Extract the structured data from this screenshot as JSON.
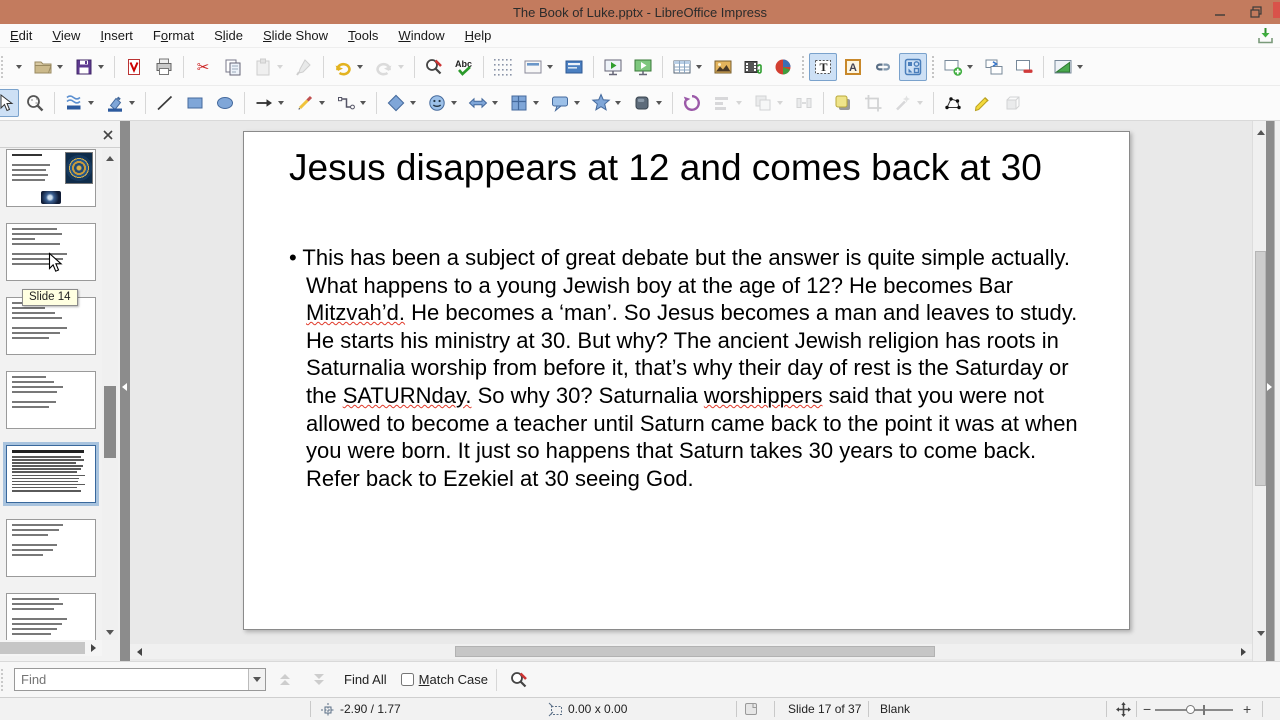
{
  "window": {
    "title": "The Book of Luke.pptx - LibreOffice Impress",
    "titlebar_color": "#c37b5e"
  },
  "menubar": {
    "items": [
      {
        "label": "Edit",
        "accel_index": 0
      },
      {
        "label": "View",
        "accel_index": 0
      },
      {
        "label": "Insert",
        "accel_index": 0
      },
      {
        "label": "Format",
        "accel_index": 1
      },
      {
        "label": "Slide",
        "accel_index": 1
      },
      {
        "label": "Slide Show",
        "accel_index": 0
      },
      {
        "label": "Tools",
        "accel_index": 0
      },
      {
        "label": "Window",
        "accel_index": 0
      },
      {
        "label": "Help",
        "accel_index": 0
      }
    ]
  },
  "toolbars": {
    "standard": [
      {
        "icon": null,
        "name": "new-document",
        "dropdown": true
      },
      {
        "icon": "open",
        "dropdown": true
      },
      {
        "icon": "save",
        "dropdown": true
      },
      {
        "sep": true
      },
      {
        "icon": "export-pdf"
      },
      {
        "icon": "print"
      },
      {
        "sep": true
      },
      {
        "icon": "cut"
      },
      {
        "icon": "copy"
      },
      {
        "icon": "paste",
        "dropdown": true,
        "disabled": true
      },
      {
        "icon": "clone-formatting",
        "disabled": true
      },
      {
        "sep": true
      },
      {
        "icon": "undo",
        "dropdown": true
      },
      {
        "icon": "redo",
        "dropdown": true,
        "disabled": true
      },
      {
        "sep": true
      },
      {
        "icon": "find-replace"
      },
      {
        "icon": "spelling"
      },
      {
        "sep": true
      },
      {
        "icon": "display-grid"
      },
      {
        "icon": "view-layout",
        "dropdown": true
      },
      {
        "icon": "master-slide"
      },
      {
        "sep": true
      },
      {
        "icon": "start-first-slide"
      },
      {
        "icon": "start-current-slide"
      },
      {
        "sep": true
      },
      {
        "icon": "insert-table",
        "dropdown": true
      },
      {
        "icon": "insert-image"
      },
      {
        "icon": "insert-media"
      },
      {
        "icon": "insert-chart"
      },
      {
        "sep": true,
        "dotted": true
      },
      {
        "icon": "insert-textbox",
        "active": true
      },
      {
        "icon": "fontwork"
      },
      {
        "icon": "hyperlink"
      },
      {
        "icon": "draw-functions",
        "active": true
      },
      {
        "sep": true,
        "dotted": true
      },
      {
        "icon": "new-slide",
        "dropdown": true
      },
      {
        "icon": "duplicate-slide"
      },
      {
        "icon": "delete-slide"
      },
      {
        "sep": true
      },
      {
        "icon": "slide-properties",
        "dropdown": true
      }
    ],
    "drawing": [
      {
        "icon": "select",
        "active": true,
        "partial": true
      },
      {
        "icon": "zoom-pan"
      },
      {
        "sep": true
      },
      {
        "icon": "line-style",
        "dropdown": true
      },
      {
        "icon": "fill-color",
        "dropdown": true
      },
      {
        "sep": true
      },
      {
        "icon": "insert-line"
      },
      {
        "icon": "rectangle"
      },
      {
        "icon": "ellipse"
      },
      {
        "sep": true
      },
      {
        "icon": "arrow-line",
        "dropdown": true
      },
      {
        "icon": "curve",
        "dropdown": true
      },
      {
        "icon": "connector",
        "dropdown": true
      },
      {
        "sep": true
      },
      {
        "icon": "basic-shapes",
        "dropdown": true
      },
      {
        "icon": "symbol-shapes",
        "dropdown": true
      },
      {
        "icon": "block-arrows",
        "dropdown": true
      },
      {
        "icon": "flowchart",
        "dropdown": true
      },
      {
        "icon": "callout",
        "dropdown": true
      },
      {
        "icon": "stars",
        "dropdown": true
      },
      {
        "icon": "threed-objects",
        "dropdown": true
      },
      {
        "sep": true
      },
      {
        "icon": "rotate"
      },
      {
        "icon": "align",
        "dropdown": true,
        "disabled": true
      },
      {
        "icon": "arrange",
        "dropdown": true,
        "disabled": true
      },
      {
        "icon": "distribute",
        "disabled": true
      },
      {
        "sep": true
      },
      {
        "icon": "shadow"
      },
      {
        "icon": "crop",
        "disabled": true
      },
      {
        "icon": "filter",
        "dropdown": true,
        "disabled": true
      },
      {
        "sep": true
      },
      {
        "icon": "edit-points"
      },
      {
        "icon": "glue-points"
      },
      {
        "icon": "extrusion",
        "disabled": true
      }
    ]
  },
  "slide_panel": {
    "tooltip": "Slide 14",
    "slides": [
      {
        "number": 13,
        "kind": "mixed"
      },
      {
        "number": 14,
        "kind": "text",
        "hovered": true
      },
      {
        "number": 15,
        "kind": "text"
      },
      {
        "number": 16,
        "kind": "text"
      },
      {
        "number": 17,
        "kind": "dense",
        "selected": true
      },
      {
        "number": 18,
        "kind": "text"
      },
      {
        "number": 19,
        "kind": "text"
      }
    ]
  },
  "canvas": {
    "slide": {
      "title": "Jesus disappears at 12 and comes back at 30",
      "bullet": "•",
      "body_segments": [
        {
          "text": "This has been a subject of great debate but the answer is quite simple actually. What happens to a young Jewish boy at the age of 12? He becomes Bar ",
          "misspelled": false
        },
        {
          "text": "Mitzvah’d.",
          "misspelled": true
        },
        {
          "text": " He becomes a ‘man’. So Jesus becomes a man and leaves to study. He starts his ministry at 30. But why? The ancient Jewish religion has roots in Saturnalia worship from before it, that’s why their day of rest is the Saturday or the ",
          "misspelled": false
        },
        {
          "text": "SATURNday.",
          "misspelled": true
        },
        {
          "text": " So why 30? Saturnalia ",
          "misspelled": false
        },
        {
          "text": "worshippers",
          "misspelled": true
        },
        {
          "text": " said that you were not allowed to become a teacher until Saturn came back to the point it was at when you were born. It just so happens that Saturn takes 30 years to come back. Refer back to Ezekiel at 30 seeing God.",
          "misspelled": false
        }
      ]
    }
  },
  "find_bar": {
    "placeholder": "Find",
    "find_all": "Find All",
    "match_case": {
      "label": "Match Case",
      "accel_index": 0,
      "checked": false
    }
  },
  "status_bar": {
    "cursor_position": "-2.90 / 1.77",
    "object_size": "0.00 x 0.00",
    "slide_info": "Slide 17 of 37",
    "layout_name": "Blank",
    "zoom_minus": "−",
    "zoom_plus": "+"
  }
}
